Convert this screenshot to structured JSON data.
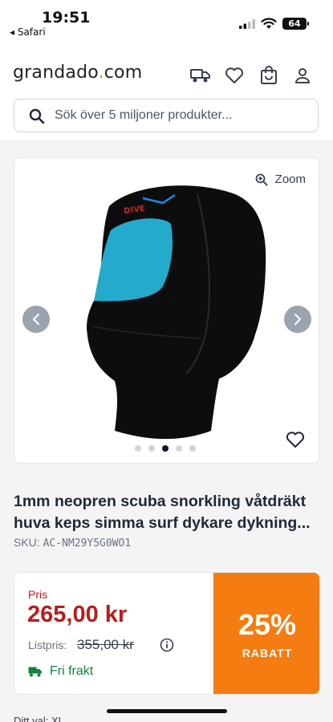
{
  "status_bar": {
    "time": "19:51",
    "back_app": "◂ Safari",
    "battery": "64"
  },
  "header": {
    "logo_main": "grandado",
    "logo_dot": ".",
    "logo_tld": "com",
    "icons": [
      "truck-icon",
      "heart-icon",
      "shopping-bag-icon",
      "user-icon"
    ],
    "search_placeholder": "Sök över 5 miljoner produkter..."
  },
  "gallery": {
    "zoom_label": "Zoom",
    "image_count": 5,
    "active_index": 2
  },
  "product": {
    "title": "1mm neopren scuba snorkling våtdräkt huva keps simma surf dykare dykning...",
    "sku_label": "SKU:",
    "sku_code": "AC-NM29Y5G0WO1"
  },
  "pricing": {
    "price_label": "Pris",
    "price": "265,00 kr",
    "list_label": "Listpris:",
    "list_price": "355,00 kr",
    "shipping": "Fri frakt",
    "discount_percent": "25%",
    "discount_label": "RABATT"
  },
  "footer": {
    "partial_text": "Ditt val: XL"
  },
  "colors": {
    "accent_orange": "#f47c10",
    "price_red": "#b91c1c",
    "shipping_green": "#15803d"
  }
}
